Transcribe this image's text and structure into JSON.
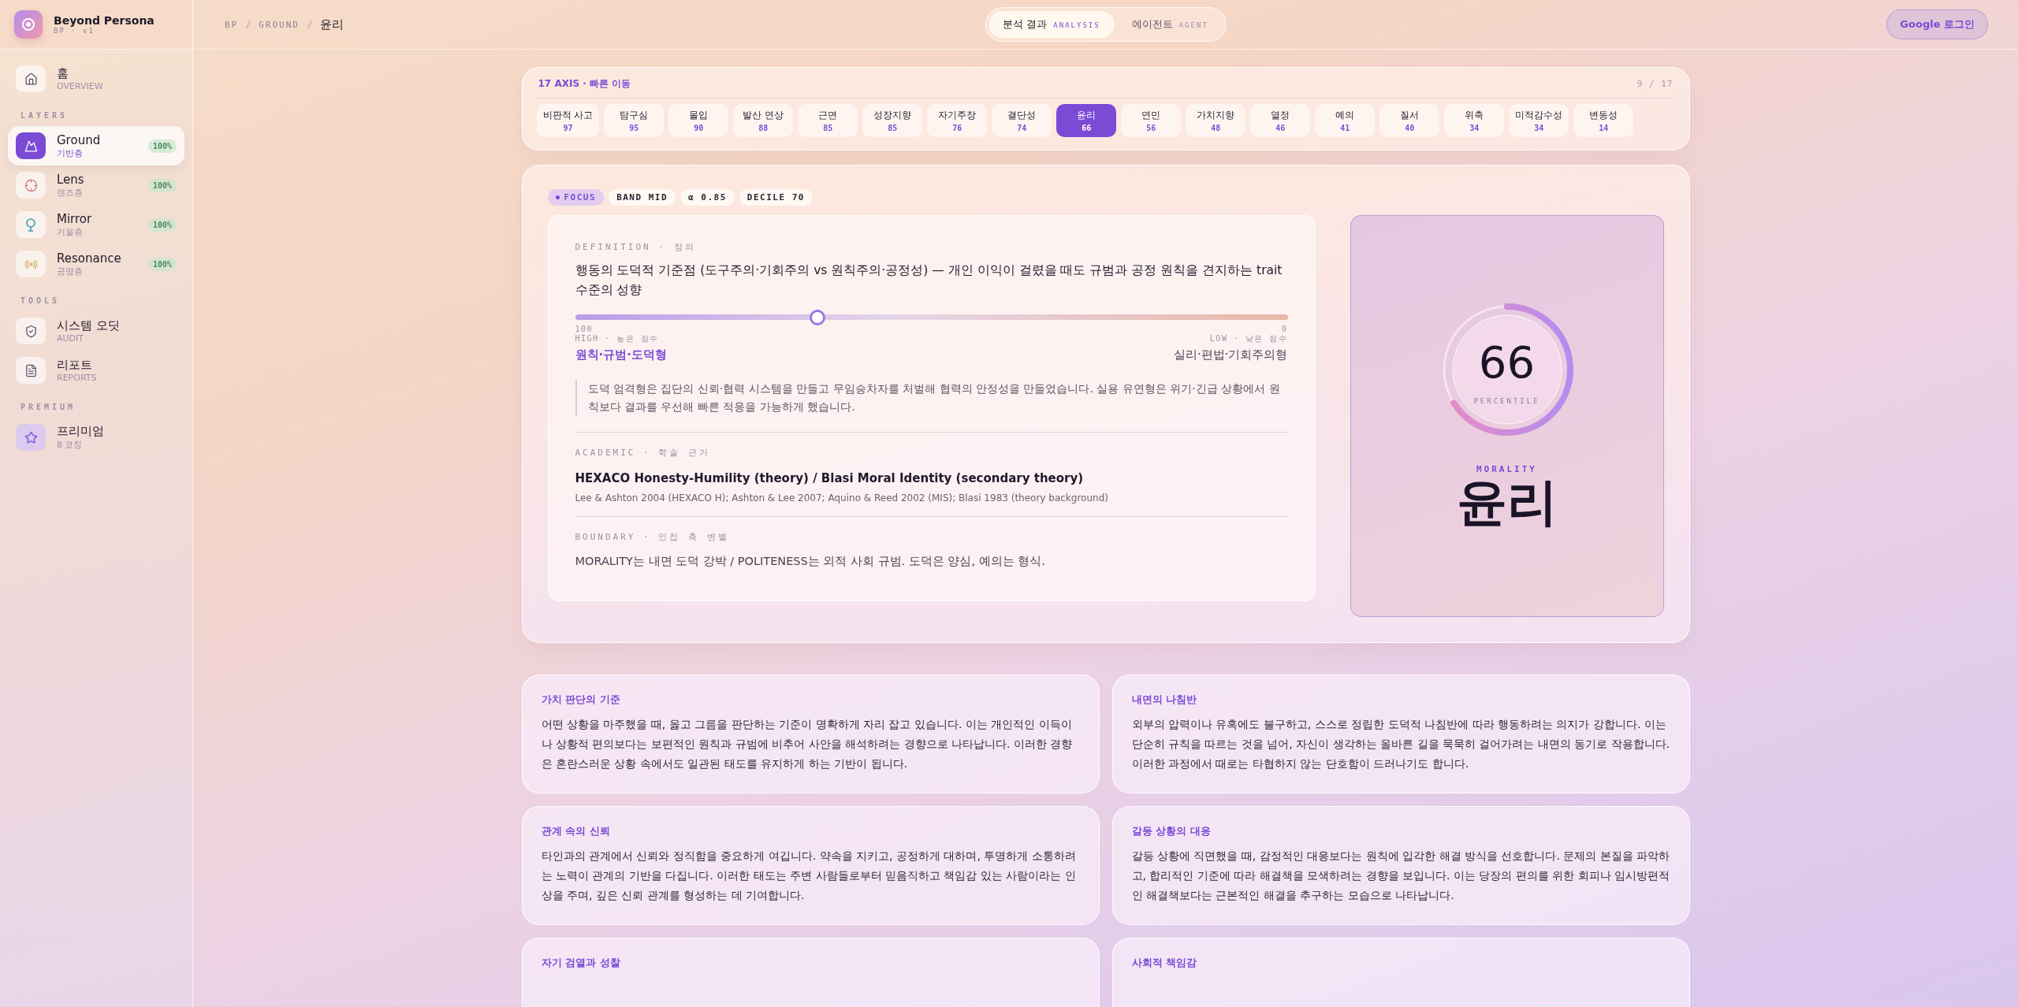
{
  "sidebar": {
    "brand": {
      "title": "Beyond Persona",
      "version": "BP · v1"
    },
    "sections": [
      {
        "items": [
          {
            "kind": "home",
            "title": "홈",
            "subtitle": "OVERVIEW",
            "selected": false
          }
        ]
      },
      {
        "heading": "LAYERS",
        "items": [
          {
            "kind": "mountain",
            "title": "Ground",
            "subtitle": "기반층",
            "badge": "100%",
            "selected": true
          },
          {
            "kind": "target",
            "title": "Lens",
            "subtitle": "렌즈층",
            "badge": "100%",
            "selected": false
          },
          {
            "kind": "mirror",
            "title": "Mirror",
            "subtitle": "거울층",
            "badge": "100%",
            "selected": false
          },
          {
            "kind": "radio",
            "title": "Resonance",
            "subtitle": "공명층",
            "badge": "100%",
            "selected": false
          }
        ]
      },
      {
        "heading": "TOOLS",
        "items": [
          {
            "kind": "shield",
            "title": "시스템 오딧",
            "subtitle": "AUDIT",
            "selected": false
          },
          {
            "kind": "file",
            "title": "리포트",
            "subtitle": "REPORTS",
            "selected": false
          }
        ]
      },
      {
        "heading": "PREMIUM",
        "items": [
          {
            "kind": "star",
            "title": "프리미엄",
            "subtitle": "8 코칭",
            "selected": false
          }
        ]
      }
    ]
  },
  "header": {
    "breadcrumb": [
      "BP",
      "GROUND",
      "윤리"
    ],
    "tabs": [
      {
        "label": "분석 결과",
        "sub": "ANALYSIS",
        "selected": true
      },
      {
        "label": "에이전트",
        "sub": "AGENT",
        "selected": false
      }
    ],
    "login": "Google 로그인"
  },
  "axis": {
    "title": "17 AXIS · 빠른 이동",
    "counter": "9 / 17",
    "items": [
      {
        "label": "비판적 사고",
        "score": "97",
        "selected": false
      },
      {
        "label": "탐구심",
        "score": "95",
        "selected": false
      },
      {
        "label": "몰입",
        "score": "90",
        "selected": false
      },
      {
        "label": "발산 연상",
        "score": "88",
        "selected": false
      },
      {
        "label": "근면",
        "score": "85",
        "selected": false
      },
      {
        "label": "성장지향",
        "score": "85",
        "selected": false
      },
      {
        "label": "자기주장",
        "score": "76",
        "selected": false
      },
      {
        "label": "결단성",
        "score": "74",
        "selected": false
      },
      {
        "label": "윤리",
        "score": "66",
        "selected": true
      },
      {
        "label": "연민",
        "score": "56",
        "selected": false
      },
      {
        "label": "가치지향",
        "score": "48",
        "selected": false
      },
      {
        "label": "열정",
        "score": "46",
        "selected": false
      },
      {
        "label": "예의",
        "score": "41",
        "selected": false
      },
      {
        "label": "질서",
        "score": "40",
        "selected": false
      },
      {
        "label": "위축",
        "score": "34",
        "selected": false
      },
      {
        "label": "미적감수성",
        "score": "34",
        "selected": false
      },
      {
        "label": "변동성",
        "score": "14",
        "selected": false
      }
    ]
  },
  "focus": {
    "chips": [
      {
        "kind": "focus",
        "label": "FOCUS"
      },
      {
        "kind": "plain",
        "label": "BAND MID"
      },
      {
        "kind": "plain",
        "label": "α 0.85"
      },
      {
        "kind": "plain",
        "label": "DECILE 70"
      }
    ],
    "definition_label": "DEFINITION · 정의",
    "definition": "행동의 도덕적 기준점 (도구주의·기회주의 vs 원칙주의·공정성) — 개인 이익이 걸렸을 때도 규범과 공정 원칙을 견지하는 trait 수준의 성향",
    "slider": {
      "level": 0.34,
      "left_value": "100",
      "right_value": "0",
      "left_caption": "HIGH · 높은 점수",
      "right_caption": "LOW · 낮은 점수",
      "high_type": "원칙·규범·도덕형",
      "low_type": "실리·편법·기회주의형"
    },
    "quote": "도덕 엄격형은 집단의 신뢰·협력 시스템을 만들고 무임승차자를 처벌해 협력의 안정성을 만들었습니다. 실용 유연형은 위기·긴급 상황에서 원칙보다 결과를 우선해 빠른 적응을 가능하게 했습니다.",
    "academic_label": "ACADEMIC · 학술 근거",
    "academic_title": "HEXACO Honesty-Humility (theory) / Blasi Moral Identity (secondary theory)",
    "academic_refs": "Lee & Ashton 2004 (HEXACO H); Ashton & Lee 2007; Aquino & Reed 2002 (MIS); Blasi 1983 (theory background)",
    "boundary_label": "BOUNDARY · 인접 축 변별",
    "boundary": "MORALITY는 내면 도덕 강박 / POLITENESS는 외적 사회 규범. 도덕은 양심, 예의는 형식.",
    "score": {
      "value": "66",
      "caption": "PERCENTILE",
      "level": 0.66,
      "english": "MORALITY",
      "name": "윤리"
    }
  },
  "insights": [
    {
      "title": "가치 판단의 기준",
      "body": "어떤 상황을 마주했을 때, 옳고 그름을 판단하는 기준이 명확하게 자리 잡고 있습니다. 이는 개인적인 이득이나 상황적 편의보다는 보편적인 원칙과 규범에 비추어 사안을 해석하려는 경향으로 나타납니다. 이러한 경향은 혼란스러운 상황 속에서도 일관된 태도를 유지하게 하는 기반이 됩니다."
    },
    {
      "title": "내면의 나침반",
      "body": "외부의 압력이나 유혹에도 불구하고, 스스로 정립한 도덕적 나침반에 따라 행동하려는 의지가 강합니다. 이는 단순히 규칙을 따르는 것을 넘어, 자신이 생각하는 올바른 길을 묵묵히 걸어가려는 내면의 동기로 작용합니다. 이러한 과정에서 때로는 타협하지 않는 단호함이 드러나기도 합니다."
    },
    {
      "title": "관계 속의 신뢰",
      "body": "타인과의 관계에서 신뢰와 정직함을 중요하게 여깁니다. 약속을 지키고, 공정하게 대하며, 투명하게 소통하려는 노력이 관계의 기반을 다집니다. 이러한 태도는 주변 사람들로부터 믿음직하고 책임감 있는 사람이라는 인상을 주며, 깊은 신뢰 관계를 형성하는 데 기여합니다."
    },
    {
      "title": "갈등 상황의 대응",
      "body": "갈등 상황에 직면했을 때, 감정적인 대응보다는 원칙에 입각한 해결 방식을 선호합니다. 문제의 본질을 파악하고, 합리적인 기준에 따라 해결책을 모색하려는 경향을 보입니다. 이는 당장의 편의를 위한 회피나 임시방편적인 해결책보다는 근본적인 해결을 추구하는 모습으로 나타납니다."
    },
    {
      "title": "자기 검열과 성찰"
    },
    {
      "title": "사회적 책임감"
    }
  ]
}
